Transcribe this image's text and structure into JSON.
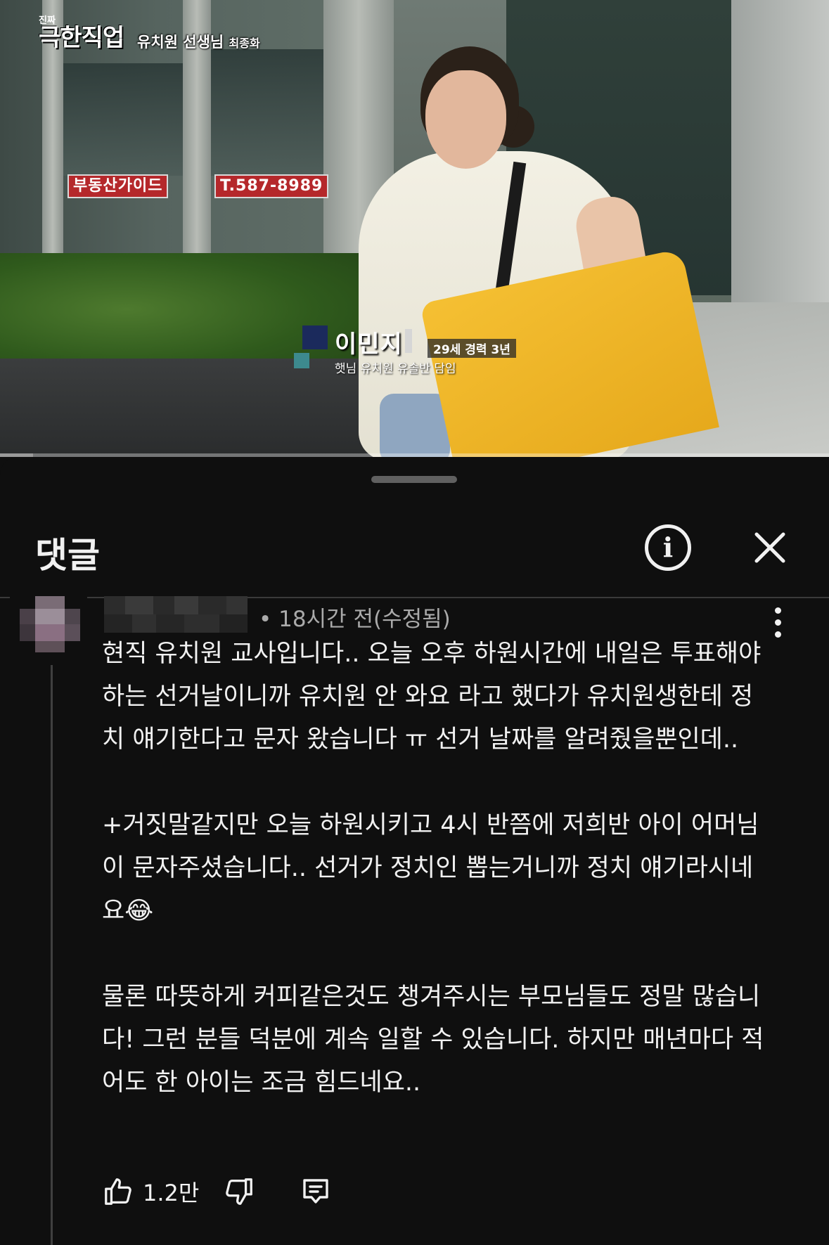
{
  "video": {
    "show_small": "진짜",
    "show_title": "극한직업",
    "episode": "유치원 선생님",
    "episode_suffix": "최종화",
    "signs": [
      "부동산가이드",
      "T.587-8989"
    ],
    "caption_name": "이민지",
    "caption_age": "29세 경력 3년",
    "caption_job": "햇님 유치원 유솔반 담임",
    "progress_fraction": 0.04
  },
  "sheet": {
    "title": "댓글"
  },
  "comment": {
    "meta": "• 18시간 전(수정됨)",
    "paragraphs": [
      "현직 유치원 교사입니다.. 오늘 오후 하원시간에 내일은 투표해야 하는 선거날이니까 유치원 안 와요 라고 했다가 유치원생한테 정치 얘기한다고 문자 왔습니다 ㅠ 선거 날짜를 알려줬을뿐인데..",
      "+거짓말같지만 오늘 하원시키고 4시 반쯤에 저희반 아이 어머님이 문자주셨습니다.. 선거가 정치인 뽑는거니까 정치 얘기라시네요😂",
      "물론 따뜻하게 커피같은것도 챙겨주시는 부모님들도 정말 많습니다! 그런 분들 덕분에 계속 일할 수 있습니다. 하지만 매년마다 적어도 한 아이는 조금 힘드네요.."
    ],
    "like_count": "1.2만"
  },
  "colors": {
    "background": "#0f0f0f",
    "text": "#f1f1f1",
    "meta": "#aaaaaa"
  }
}
